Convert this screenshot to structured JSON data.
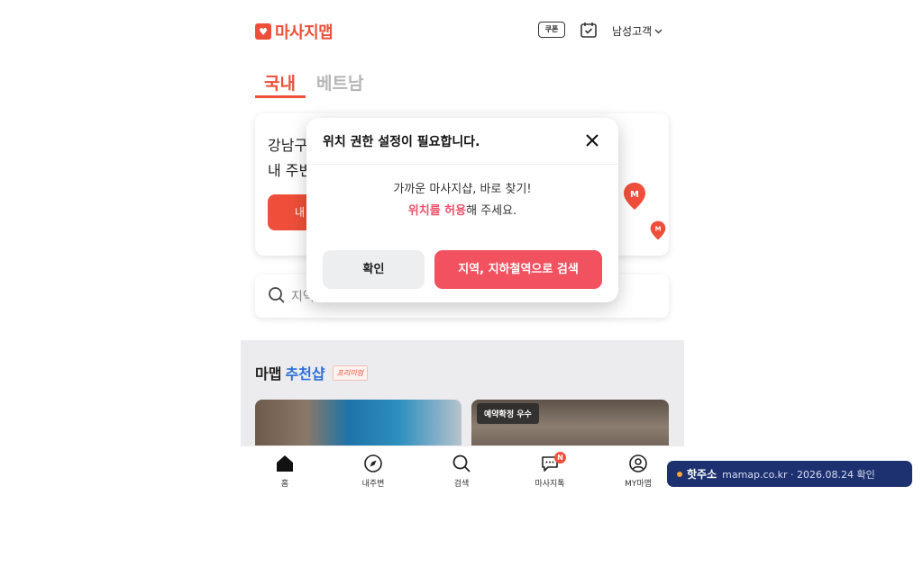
{
  "header": {
    "logo_text": "마사지맵",
    "coupon_label": "쿠폰",
    "gender_label": "남성고객"
  },
  "tabs": [
    {
      "label": "국내",
      "active": true
    },
    {
      "label": "베트남",
      "active": false
    }
  ],
  "location_card": {
    "line1": "강남구",
    "line2": "내 주변",
    "button_label": "내"
  },
  "search": {
    "placeholder": "지역"
  },
  "recommend": {
    "title_plain": "마맵",
    "title_highlight": "추천샵",
    "premium_badge": "프리미엄",
    "shops": [
      {
        "badge": ""
      },
      {
        "badge": "예약확정 우수"
      }
    ]
  },
  "bottom_nav": [
    {
      "label": "홈",
      "icon": "home-icon"
    },
    {
      "label": "내주변",
      "icon": "compass-icon"
    },
    {
      "label": "검색",
      "icon": "search-icon"
    },
    {
      "label": "마사지톡",
      "icon": "chat-icon",
      "badge": "N"
    },
    {
      "label": "MY마맵",
      "icon": "user-icon"
    }
  ],
  "modal": {
    "title": "위치 권한 설정이 필요합니다.",
    "message_line1": "가까운 마사지샵, 바로 찾기!",
    "message_highlight": "위치를 허용",
    "message_line2_rest": "해 주세요.",
    "ok_label": "확인",
    "search_label": "지역, 지하철역으로 검색"
  },
  "toast": {
    "title": "핫주소",
    "info": "mamap.co.kr · 2026.08.24 확인"
  },
  "colors": {
    "brand": "#ef4f3a",
    "modal_primary": "#f2515f",
    "toast_bg": "#1d3170"
  }
}
